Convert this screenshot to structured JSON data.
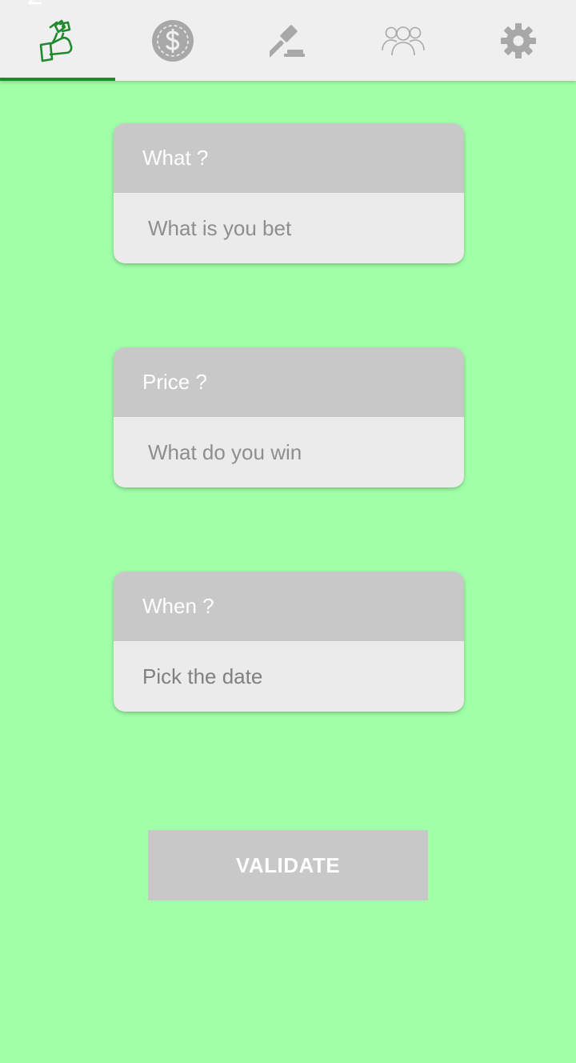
{
  "tabs": [
    {
      "icon": "money-hand-icon",
      "active": true
    },
    {
      "icon": "dollar-coin-icon",
      "active": false
    },
    {
      "icon": "gavel-icon",
      "active": false
    },
    {
      "icon": "group-icon",
      "active": false
    },
    {
      "icon": "gear-icon",
      "active": false
    }
  ],
  "colors": {
    "background": "#a0ffa8",
    "tabbar": "#efefef",
    "accent": "#1d8a2c",
    "icon_inactive": "#a8a8a8",
    "card_header": "#c8c8c8",
    "card_body": "#ebebeb"
  },
  "form": {
    "what": {
      "label": "What ?",
      "placeholder": "What is you bet",
      "value": ""
    },
    "price": {
      "label": "Price ?",
      "placeholder": "What do you win",
      "value": ""
    },
    "when": {
      "label": "When ?",
      "value": "Pick the date"
    }
  },
  "validate_label": "VALIDATE"
}
